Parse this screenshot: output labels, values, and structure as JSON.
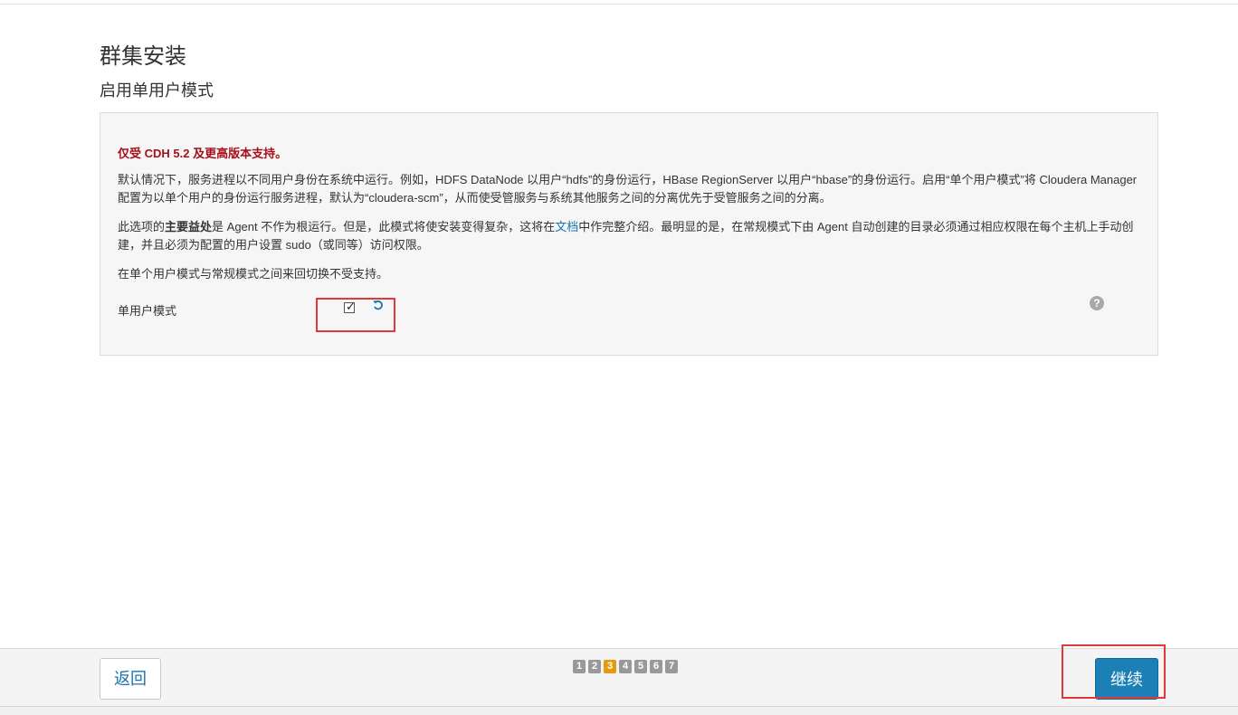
{
  "header": {
    "title": "群集安装",
    "subtitle": "启用单用户模式"
  },
  "panel": {
    "warning": "仅受 CDH 5.2 及更高版本支持。",
    "paragraph1": "默认情况下，服务进程以不同用户身份在系统中运行。例如，HDFS DataNode 以用户“hdfs”的身份运行，HBase RegionServer 以用户“hbase”的身份运行。启用“单个用户模式”将 Cloudera Manager 配置为以单个用户的身份运行服务进程，默认为“cloudera-scm”，从而使受管服务与系统其他服务之间的分离优先于受管服务之间的分离。",
    "paragraph2_before": "此选项的",
    "paragraph2_bold": "主要益处",
    "paragraph2_mid": "是 Agent 不作为根运行。但是，此模式将使安装变得复杂，这将在",
    "paragraph2_link": "文档",
    "paragraph2_after": "中作完整介绍。最明显的是，在常规模式下由 Agent 自动创建的目录必须通过相应权限在每个主机上手动创建，并且必须为配置的用户设置 sudo（或同等）访问权限。",
    "paragraph3": "在单个用户模式与常规模式之间来回切换不受支持。",
    "field_label": "单用户模式",
    "checkbox_checked": true,
    "help_glyph": "?"
  },
  "footer": {
    "back_label": "返回",
    "continue_label": "继续",
    "steps": [
      "1",
      "2",
      "3",
      "4",
      "5",
      "6",
      "7"
    ],
    "active_step": 3
  },
  "icons": {
    "checkbox": "check-icon",
    "reset": "undo-icon",
    "help": "question-circle-icon"
  },
  "colors": {
    "warning": "#a5101b",
    "link": "#1a74b0",
    "primary_button": "#1c7fb5",
    "active_step": "#e49b0f",
    "highlight": "#e0393b"
  }
}
